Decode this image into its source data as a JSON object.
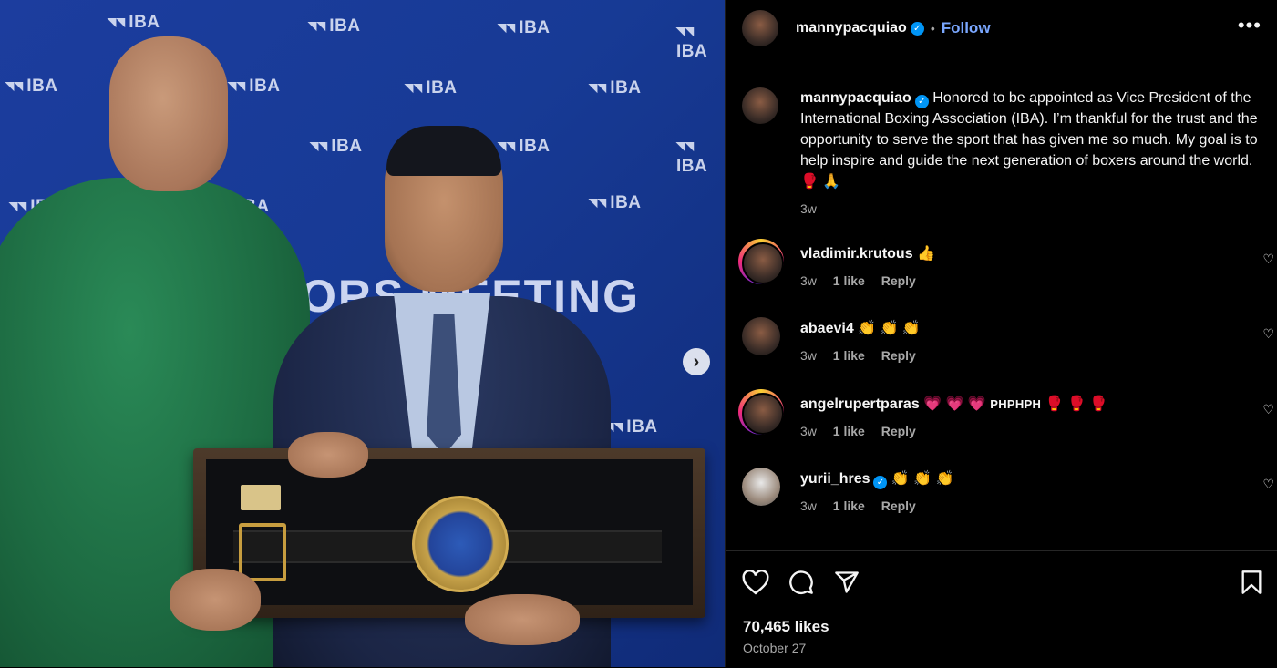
{
  "photo": {
    "backdrop_logo_text": "IBA",
    "backdrop_word": "ORS MEETING",
    "next_button": "›"
  },
  "header": {
    "username": "mannypacquiao",
    "verified_mark": "✓",
    "separator": "•",
    "follow_label": "Follow",
    "more_label": "•••"
  },
  "caption": {
    "username": "mannypacquiao",
    "text": " Honored to be appointed as Vice President of the International Boxing Association (IBA). I’m thankful for the trust and the opportunity to serve the sport that has given me so much. My goal is to help inspire and guide the next generation of boxers around the world. 🥊 🙏",
    "time": "3w"
  },
  "comments": [
    {
      "username": "vladimir.krutous",
      "verified": false,
      "text": " 👍",
      "time": "3w",
      "likes": "1 like",
      "reply": "Reply",
      "story_ring": true
    },
    {
      "username": "abaevi4",
      "verified": false,
      "text": " 👏 👏 👏",
      "time": "3w",
      "likes": "1 like",
      "reply": "Reply",
      "story_ring": false
    },
    {
      "username": "angelrupertparas",
      "verified": false,
      "text": " 💗 💗 💗 ",
      "tail": "PHPHPH",
      "tail2": " 🥊 🥊 🥊",
      "time": "3w",
      "likes": "1 like",
      "reply": "Reply",
      "story_ring": true
    },
    {
      "username": "yurii_hres",
      "verified": true,
      "text": " 👏 👏 👏",
      "time": "3w",
      "likes": "1 like",
      "reply": "Reply",
      "story_ring": false
    }
  ],
  "actions": {
    "likes": "70,465 likes",
    "date": "October 27"
  },
  "colors": {
    "follow": "#7aa7ff",
    "verified": "#0095f6",
    "muted": "#a8a8a8",
    "panel_bg": "#000000"
  },
  "icons": [
    "heart-icon",
    "comment-icon",
    "share-icon",
    "bookmark-icon",
    "more-icon",
    "chevron-right-icon",
    "verified-icon"
  ]
}
